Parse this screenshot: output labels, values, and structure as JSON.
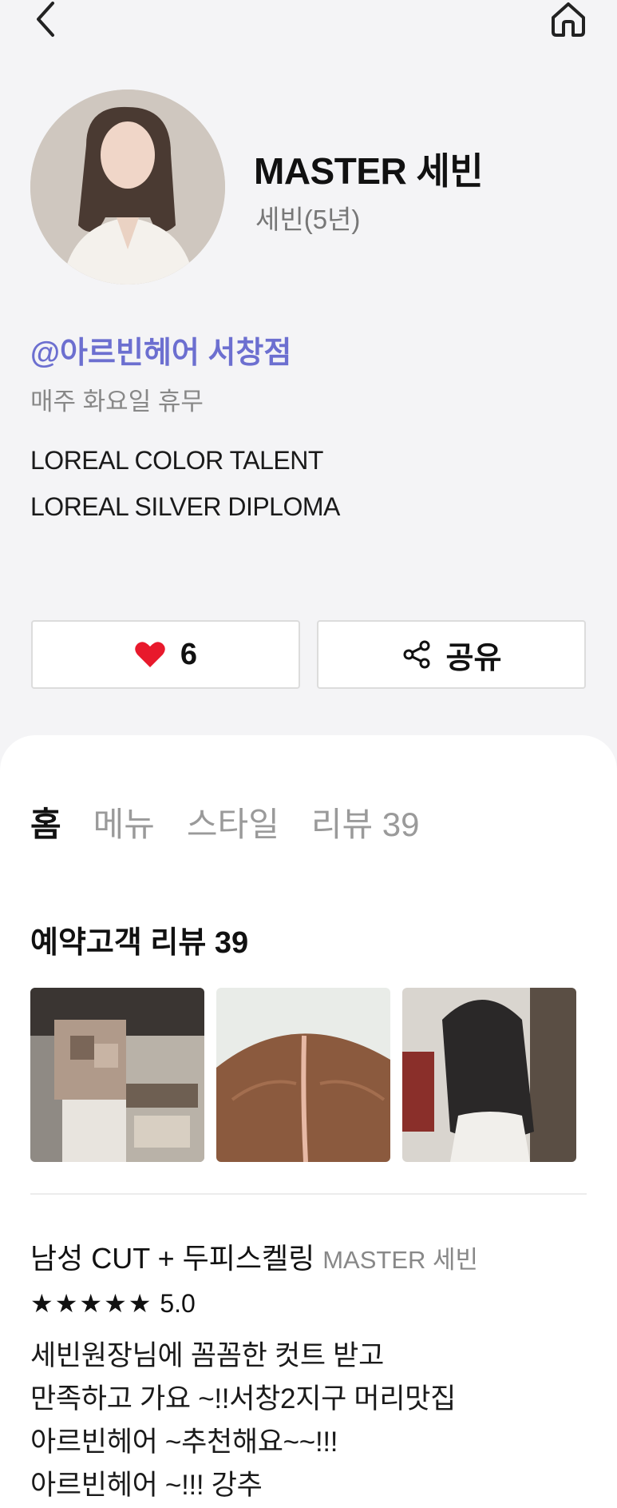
{
  "profile": {
    "name": "MASTER 세빈",
    "subtitle": "세빈(5년)",
    "salon": "@아르빈헤어 서창점",
    "closed_day": "매주 화요일 휴무",
    "certifications": [
      "LOREAL COLOR TALENT",
      "LOREAL SILVER DIPLOMA"
    ]
  },
  "actions": {
    "like_count": "6",
    "share_label": "공유"
  },
  "tabs": [
    {
      "label": "홈",
      "active": true
    },
    {
      "label": "메뉴",
      "active": false
    },
    {
      "label": "스타일",
      "active": false
    },
    {
      "label": "리뷰 39",
      "active": false
    }
  ],
  "reviews": {
    "heading": "예약고객 리뷰 39",
    "item": {
      "service": "남성 CUT + 두피스켈링",
      "designer": "MASTER 세빈",
      "stars": "★★★★★",
      "score": "5.0",
      "lines": [
        "세빈원장님에 꼼꼼한 컷트 받고",
        "만족하고 가요 ~!!서창2지구 머리맛집",
        "아르빈헤어  ~추천해요~~!!!",
        "아르빈헤어 ~!!! 강추"
      ]
    }
  },
  "colors": {
    "accent": "#6c6fd0",
    "heart": "#e8192c",
    "tab_highlight": "#ffe400"
  }
}
